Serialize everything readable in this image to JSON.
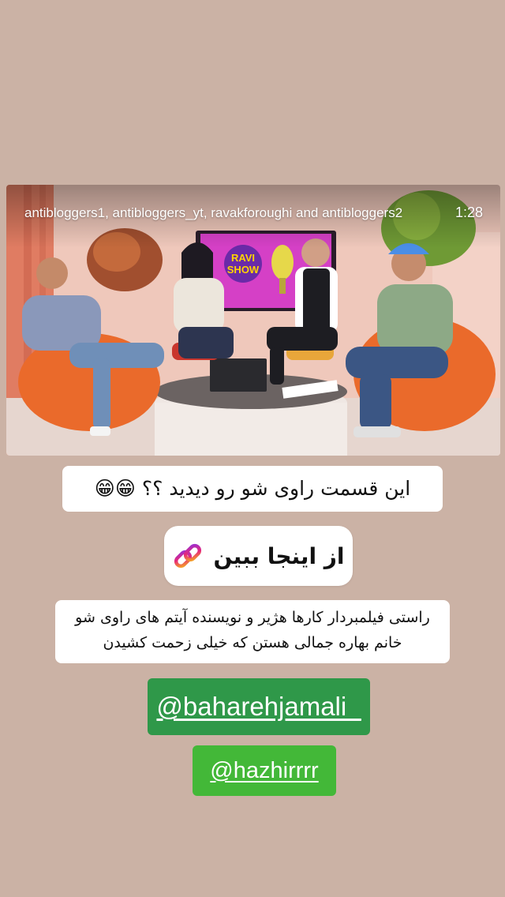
{
  "story": {
    "background_color": "#cbb2a5"
  },
  "video": {
    "caption": "antibloggers1, antibloggers_yt, ravakforoughi and antibloggers2",
    "duration": "1:28",
    "show_logo_line1": "RAVI",
    "show_logo_line2": "SHOW"
  },
  "question_text": "این قسمت راوی شو رو دیدید ؟؟ 😁😁",
  "link": {
    "label": "از اینجا ببین",
    "icon": "link-icon",
    "gradient": [
      "#f5a623",
      "#e6287a",
      "#9b2fd1"
    ]
  },
  "description": "راستی فیلمبردار کارها هژیر و نویسنده آیتم های راوی شو خانم بهاره جمالی هستن که خیلی زحمت کشیدن",
  "mentions": [
    {
      "handle": "@baharehjamali_",
      "color": "#2f9849"
    },
    {
      "handle": "@hazhirrrr",
      "color": "#43b838"
    }
  ]
}
